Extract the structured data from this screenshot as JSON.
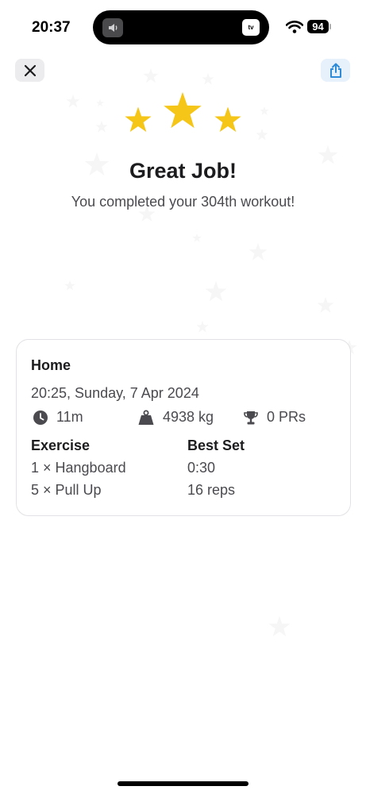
{
  "status_bar": {
    "time": "20:37",
    "island_app_label": "tv",
    "battery": "94"
  },
  "colors": {
    "star_gold": "#f5c518",
    "share_blue": "#2f8ad8",
    "text_dark": "#1c1c1e",
    "text_gray": "#4a4a4f"
  },
  "hero": {
    "title": "Great Job!",
    "subtitle": "You completed your 304th workout!"
  },
  "summary": {
    "name": "Home",
    "datetime": "20:25, Sunday, 7 Apr 2024",
    "duration": "11m",
    "volume": "4938 kg",
    "prs": "0 PRs",
    "exercise_header": "Exercise",
    "best_set_header": "Best Set",
    "exercises": [
      {
        "name": "1 × Hangboard",
        "best_set": "0:30"
      },
      {
        "name": "5 × Pull Up",
        "best_set": "16 reps"
      }
    ]
  },
  "icons": {
    "close": "close-icon",
    "share": "share-icon",
    "duration": "clock-icon",
    "volume": "weight-icon",
    "prs": "trophy-icon"
  }
}
